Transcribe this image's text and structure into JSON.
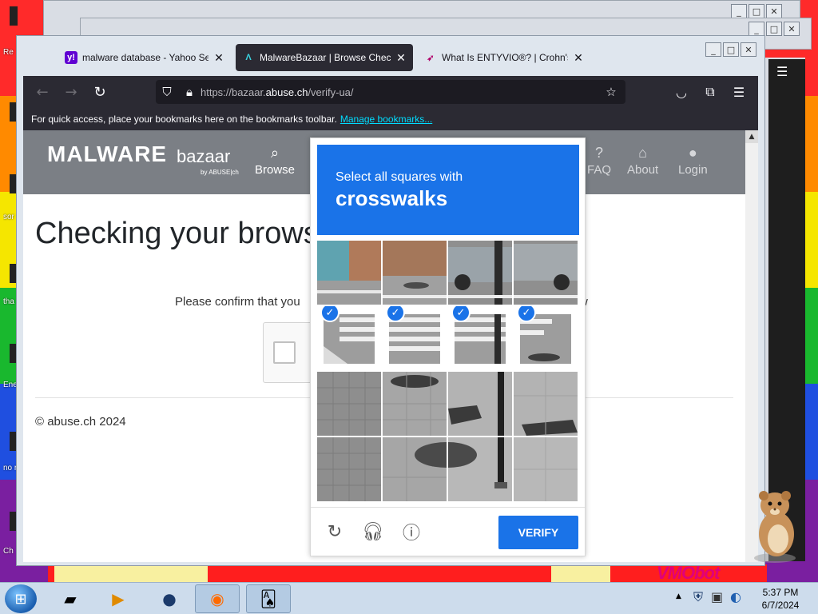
{
  "browser": {
    "tabs": [
      {
        "favicon": "yahoo-favicon",
        "title": "malware database - Yahoo Search",
        "active": false
      },
      {
        "favicon": "malwarebazaar-favicon",
        "title": "MalwareBazaar | Browse Checking",
        "active": true
      },
      {
        "favicon": "entyvio-favicon",
        "title": "What Is ENTYVIO®? | Crohn's and",
        "active": false
      }
    ],
    "url_prefix": "https://bazaar.",
    "url_domain": "abuse.ch",
    "url_path": "/verify-ua/",
    "bookmarks_text": "For quick access, place your bookmarks here on the bookmarks toolbar.",
    "bookmarks_link": "Manage bookmarks..."
  },
  "site": {
    "logo_main": "MALWARE",
    "logo_sub": "bazaar",
    "logo_by": "by ABUSE|ch",
    "nav": [
      {
        "icon": "search-icon",
        "label": "Browse"
      },
      {
        "icon": "question-icon",
        "label": "FAQ"
      },
      {
        "icon": "building-icon",
        "label": "About"
      },
      {
        "icon": "user-icon",
        "label": "Login"
      }
    ],
    "page_title": "Checking your browser",
    "confirm_text": "Please confirm that you",
    "confirm_tail": "w",
    "footer": "© abuse.ch 2024"
  },
  "captcha": {
    "prompt_line1": "Select all squares with",
    "prompt_word": "crosswalks",
    "selected_cells": [
      4,
      5,
      6,
      7
    ],
    "verify_label": "VERIFY",
    "accent": "#1a73e8"
  },
  "desktop": {
    "labels": [
      "Re",
      "sor",
      "tha",
      "Ene",
      "no ret",
      "Ch"
    ],
    "watermark": "VMObot"
  },
  "taskbar": {
    "time": "5:37 PM",
    "date": "6/7/2024"
  }
}
